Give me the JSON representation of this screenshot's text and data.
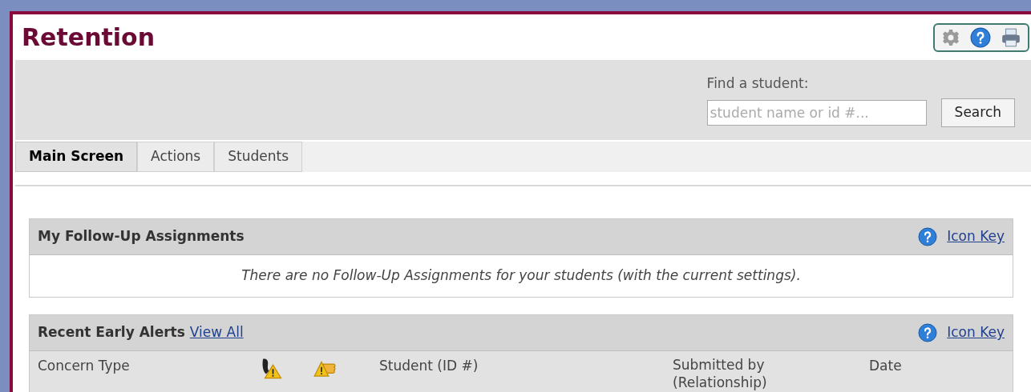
{
  "title": "Retention",
  "search": {
    "label": "Find a student:",
    "placeholder": "student name or id #...",
    "button": "Search"
  },
  "tabs": [
    {
      "label": "Main Screen",
      "selected": true
    },
    {
      "label": "Actions",
      "selected": false
    },
    {
      "label": "Students",
      "selected": false
    }
  ],
  "follow_up": {
    "title": "My Follow-Up Assignments",
    "icon_key": "Icon Key",
    "message": "There are no Follow-Up Assignments for your students (with the current settings)."
  },
  "alerts": {
    "title": "Recent Early Alerts",
    "view_all": "View All",
    "icon_key": "Icon Key",
    "columns": [
      "Concern Type",
      "Student (ID #)",
      "Submitted by (Relationship)",
      "Date"
    ]
  }
}
